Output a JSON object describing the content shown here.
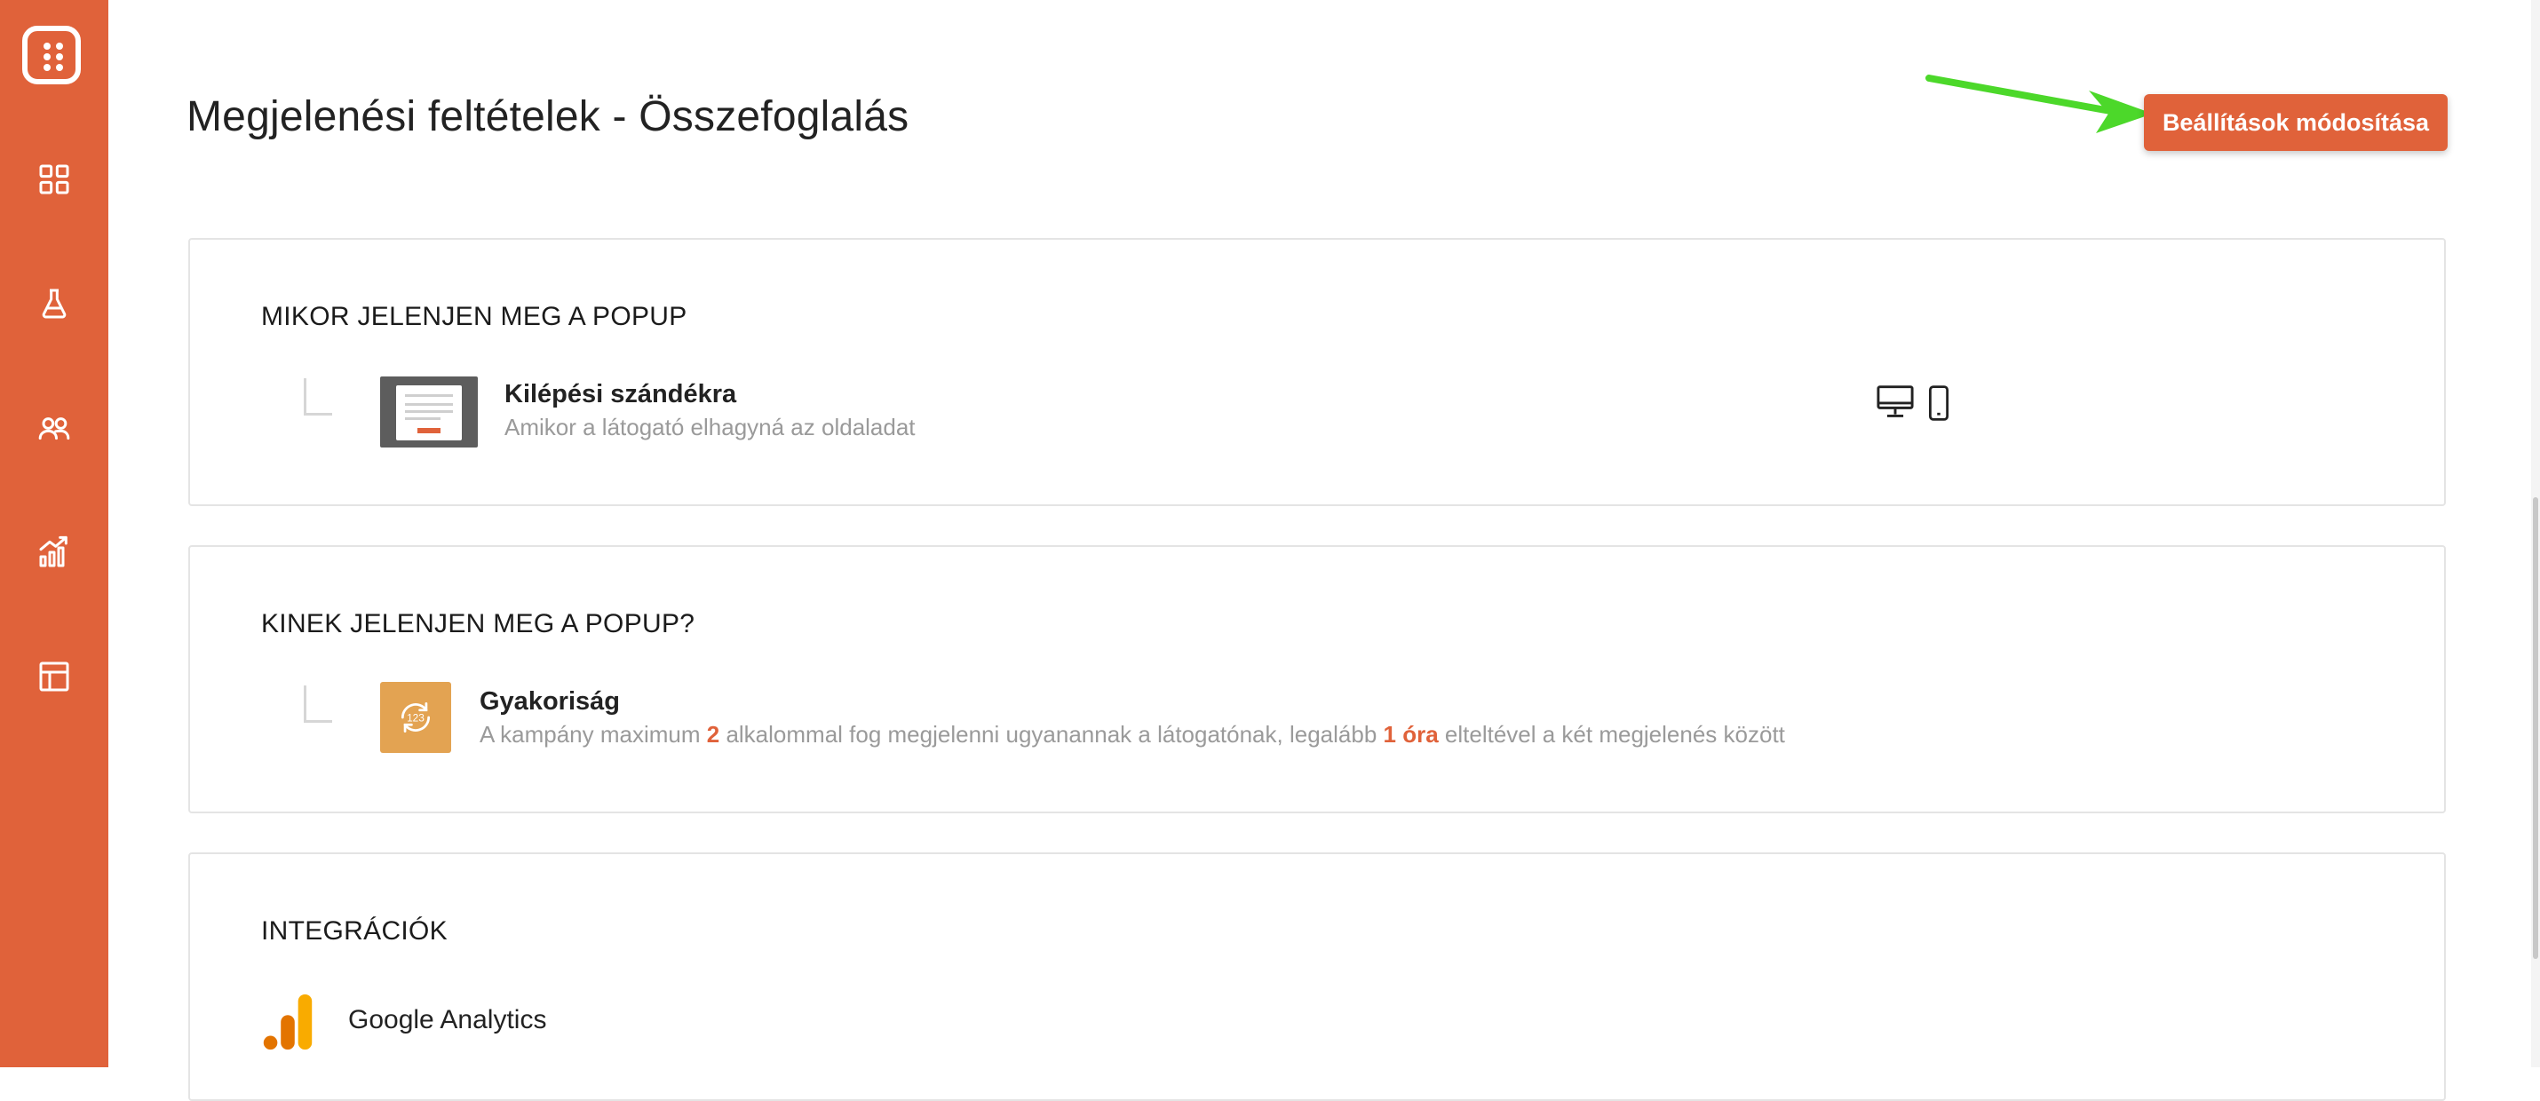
{
  "sidebar": {
    "items": [
      {
        "name": "dashboard",
        "icon": "grid-icon"
      },
      {
        "name": "experiments",
        "icon": "flask-icon"
      },
      {
        "name": "audience",
        "icon": "users-icon"
      },
      {
        "name": "analytics",
        "icon": "chart-icon"
      },
      {
        "name": "templates",
        "icon": "layout-icon"
      }
    ],
    "color": "#E0623A"
  },
  "header": {
    "title": "Megjelenési feltételek - Összefoglalás",
    "edit_button_label": "Beállítások módosítása"
  },
  "when_card": {
    "title": "MIKOR JELENJEN MEG A POPUP",
    "item_title": "Kilépési szándékra",
    "item_desc": "Amikor a látogató elhagyná az oldaladat",
    "devices": [
      "desktop-icon",
      "mobile-icon"
    ]
  },
  "who_card": {
    "title": "KINEK JELENJEN MEG A POPUP?",
    "item_title": "Gyakoriság",
    "desc_part1": "A kampány maximum ",
    "desc_count": "2",
    "desc_part2": " alkalommal fog megjelenni ugyanannak a látogatónak, legalább ",
    "desc_time": "1 óra",
    "desc_part3": " elteltével a két megjelenés között"
  },
  "integrations_card": {
    "title": "INTEGRÁCIÓK",
    "items": [
      {
        "label": "Google Analytics"
      }
    ]
  },
  "colors": {
    "accent": "#E0623A",
    "frequency_icon": "#E3A352",
    "annotation_arrow": "#4CD82A"
  }
}
